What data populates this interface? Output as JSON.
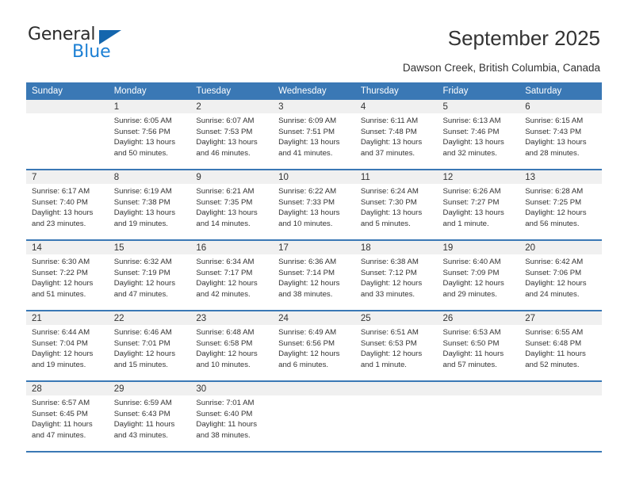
{
  "brand": {
    "name_top": "General",
    "name_bottom": "Blue",
    "triangle_color": "#1466ad",
    "blue_color": "#1b7fd4"
  },
  "header": {
    "title": "September 2025",
    "subtitle": "Dawson Creek, British Columbia, Canada",
    "accent_color": "#3a78b5",
    "daynum_bg": "#f0f0f0"
  },
  "weekdays": [
    "Sunday",
    "Monday",
    "Tuesday",
    "Wednesday",
    "Thursday",
    "Friday",
    "Saturday"
  ],
  "weeks": [
    [
      {
        "day": "",
        "sunrise": "",
        "sunset": "",
        "daylight1": "",
        "daylight2": ""
      },
      {
        "day": "1",
        "sunrise": "Sunrise: 6:05 AM",
        "sunset": "Sunset: 7:56 PM",
        "daylight1": "Daylight: 13 hours",
        "daylight2": "and 50 minutes."
      },
      {
        "day": "2",
        "sunrise": "Sunrise: 6:07 AM",
        "sunset": "Sunset: 7:53 PM",
        "daylight1": "Daylight: 13 hours",
        "daylight2": "and 46 minutes."
      },
      {
        "day": "3",
        "sunrise": "Sunrise: 6:09 AM",
        "sunset": "Sunset: 7:51 PM",
        "daylight1": "Daylight: 13 hours",
        "daylight2": "and 41 minutes."
      },
      {
        "day": "4",
        "sunrise": "Sunrise: 6:11 AM",
        "sunset": "Sunset: 7:48 PM",
        "daylight1": "Daylight: 13 hours",
        "daylight2": "and 37 minutes."
      },
      {
        "day": "5",
        "sunrise": "Sunrise: 6:13 AM",
        "sunset": "Sunset: 7:46 PM",
        "daylight1": "Daylight: 13 hours",
        "daylight2": "and 32 minutes."
      },
      {
        "day": "6",
        "sunrise": "Sunrise: 6:15 AM",
        "sunset": "Sunset: 7:43 PM",
        "daylight1": "Daylight: 13 hours",
        "daylight2": "and 28 minutes."
      }
    ],
    [
      {
        "day": "7",
        "sunrise": "Sunrise: 6:17 AM",
        "sunset": "Sunset: 7:40 PM",
        "daylight1": "Daylight: 13 hours",
        "daylight2": "and 23 minutes."
      },
      {
        "day": "8",
        "sunrise": "Sunrise: 6:19 AM",
        "sunset": "Sunset: 7:38 PM",
        "daylight1": "Daylight: 13 hours",
        "daylight2": "and 19 minutes."
      },
      {
        "day": "9",
        "sunrise": "Sunrise: 6:21 AM",
        "sunset": "Sunset: 7:35 PM",
        "daylight1": "Daylight: 13 hours",
        "daylight2": "and 14 minutes."
      },
      {
        "day": "10",
        "sunrise": "Sunrise: 6:22 AM",
        "sunset": "Sunset: 7:33 PM",
        "daylight1": "Daylight: 13 hours",
        "daylight2": "and 10 minutes."
      },
      {
        "day": "11",
        "sunrise": "Sunrise: 6:24 AM",
        "sunset": "Sunset: 7:30 PM",
        "daylight1": "Daylight: 13 hours",
        "daylight2": "and 5 minutes."
      },
      {
        "day": "12",
        "sunrise": "Sunrise: 6:26 AM",
        "sunset": "Sunset: 7:27 PM",
        "daylight1": "Daylight: 13 hours",
        "daylight2": "and 1 minute."
      },
      {
        "day": "13",
        "sunrise": "Sunrise: 6:28 AM",
        "sunset": "Sunset: 7:25 PM",
        "daylight1": "Daylight: 12 hours",
        "daylight2": "and 56 minutes."
      }
    ],
    [
      {
        "day": "14",
        "sunrise": "Sunrise: 6:30 AM",
        "sunset": "Sunset: 7:22 PM",
        "daylight1": "Daylight: 12 hours",
        "daylight2": "and 51 minutes."
      },
      {
        "day": "15",
        "sunrise": "Sunrise: 6:32 AM",
        "sunset": "Sunset: 7:19 PM",
        "daylight1": "Daylight: 12 hours",
        "daylight2": "and 47 minutes."
      },
      {
        "day": "16",
        "sunrise": "Sunrise: 6:34 AM",
        "sunset": "Sunset: 7:17 PM",
        "daylight1": "Daylight: 12 hours",
        "daylight2": "and 42 minutes."
      },
      {
        "day": "17",
        "sunrise": "Sunrise: 6:36 AM",
        "sunset": "Sunset: 7:14 PM",
        "daylight1": "Daylight: 12 hours",
        "daylight2": "and 38 minutes."
      },
      {
        "day": "18",
        "sunrise": "Sunrise: 6:38 AM",
        "sunset": "Sunset: 7:12 PM",
        "daylight1": "Daylight: 12 hours",
        "daylight2": "and 33 minutes."
      },
      {
        "day": "19",
        "sunrise": "Sunrise: 6:40 AM",
        "sunset": "Sunset: 7:09 PM",
        "daylight1": "Daylight: 12 hours",
        "daylight2": "and 29 minutes."
      },
      {
        "day": "20",
        "sunrise": "Sunrise: 6:42 AM",
        "sunset": "Sunset: 7:06 PM",
        "daylight1": "Daylight: 12 hours",
        "daylight2": "and 24 minutes."
      }
    ],
    [
      {
        "day": "21",
        "sunrise": "Sunrise: 6:44 AM",
        "sunset": "Sunset: 7:04 PM",
        "daylight1": "Daylight: 12 hours",
        "daylight2": "and 19 minutes."
      },
      {
        "day": "22",
        "sunrise": "Sunrise: 6:46 AM",
        "sunset": "Sunset: 7:01 PM",
        "daylight1": "Daylight: 12 hours",
        "daylight2": "and 15 minutes."
      },
      {
        "day": "23",
        "sunrise": "Sunrise: 6:48 AM",
        "sunset": "Sunset: 6:58 PM",
        "daylight1": "Daylight: 12 hours",
        "daylight2": "and 10 minutes."
      },
      {
        "day": "24",
        "sunrise": "Sunrise: 6:49 AM",
        "sunset": "Sunset: 6:56 PM",
        "daylight1": "Daylight: 12 hours",
        "daylight2": "and 6 minutes."
      },
      {
        "day": "25",
        "sunrise": "Sunrise: 6:51 AM",
        "sunset": "Sunset: 6:53 PM",
        "daylight1": "Daylight: 12 hours",
        "daylight2": "and 1 minute."
      },
      {
        "day": "26",
        "sunrise": "Sunrise: 6:53 AM",
        "sunset": "Sunset: 6:50 PM",
        "daylight1": "Daylight: 11 hours",
        "daylight2": "and 57 minutes."
      },
      {
        "day": "27",
        "sunrise": "Sunrise: 6:55 AM",
        "sunset": "Sunset: 6:48 PM",
        "daylight1": "Daylight: 11 hours",
        "daylight2": "and 52 minutes."
      }
    ],
    [
      {
        "day": "28",
        "sunrise": "Sunrise: 6:57 AM",
        "sunset": "Sunset: 6:45 PM",
        "daylight1": "Daylight: 11 hours",
        "daylight2": "and 47 minutes."
      },
      {
        "day": "29",
        "sunrise": "Sunrise: 6:59 AM",
        "sunset": "Sunset: 6:43 PM",
        "daylight1": "Daylight: 11 hours",
        "daylight2": "and 43 minutes."
      },
      {
        "day": "30",
        "sunrise": "Sunrise: 7:01 AM",
        "sunset": "Sunset: 6:40 PM",
        "daylight1": "Daylight: 11 hours",
        "daylight2": "and 38 minutes."
      },
      {
        "day": "",
        "sunrise": "",
        "sunset": "",
        "daylight1": "",
        "daylight2": ""
      },
      {
        "day": "",
        "sunrise": "",
        "sunset": "",
        "daylight1": "",
        "daylight2": ""
      },
      {
        "day": "",
        "sunrise": "",
        "sunset": "",
        "daylight1": "",
        "daylight2": ""
      },
      {
        "day": "",
        "sunrise": "",
        "sunset": "",
        "daylight1": "",
        "daylight2": ""
      }
    ]
  ]
}
